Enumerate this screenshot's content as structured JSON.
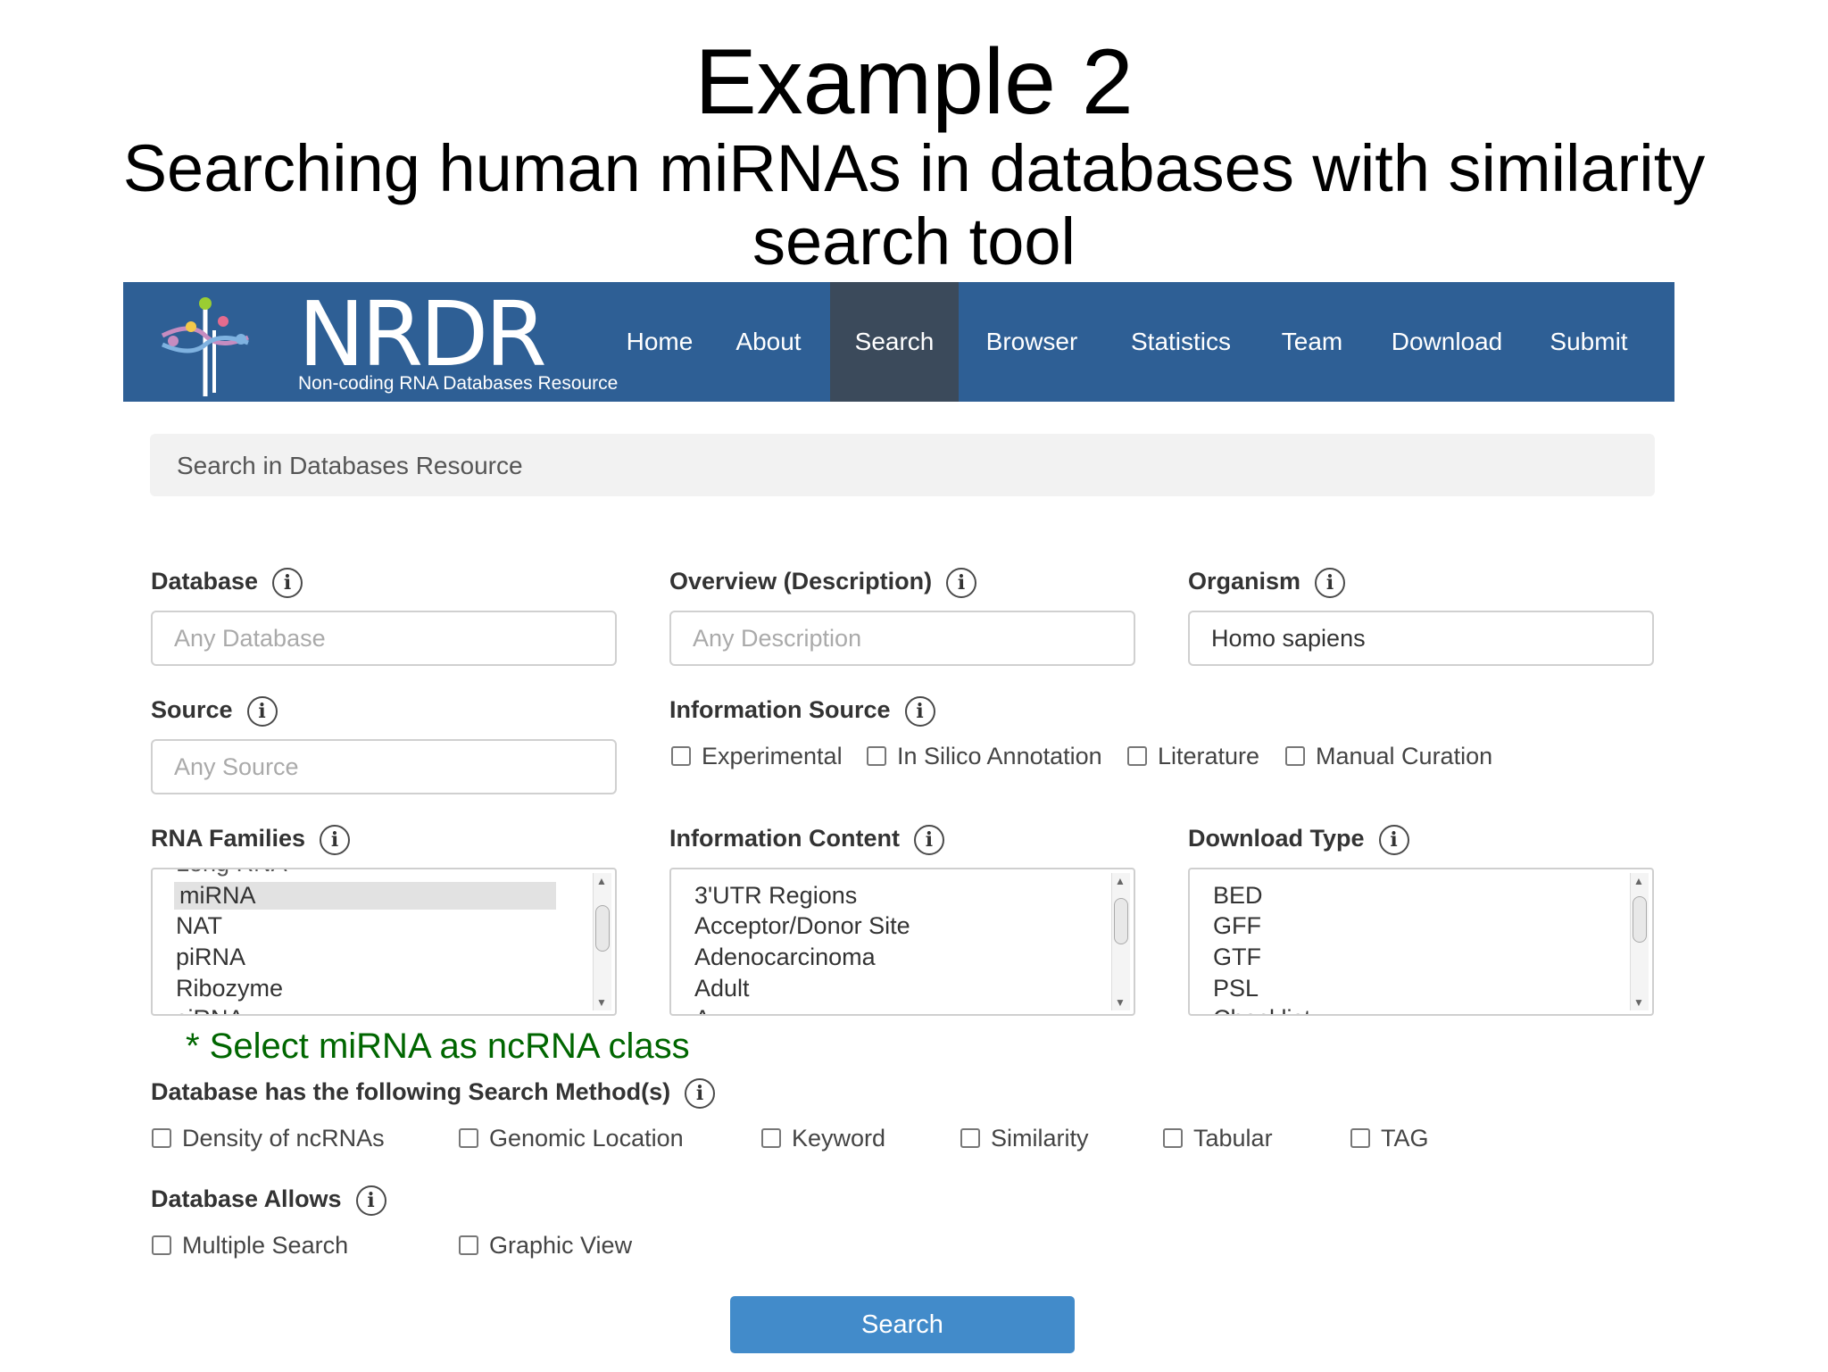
{
  "slide": {
    "title": "Example 2",
    "subtitle": "Searching human miRNAs in databases with similarity search tool"
  },
  "navbar": {
    "logo_text": "NRDR",
    "logo_subtitle": "Non-coding RNA Databases Resource",
    "items": [
      {
        "label": "Home"
      },
      {
        "label": "About"
      },
      {
        "label": "Search"
      },
      {
        "label": "Browser"
      },
      {
        "label": "Statistics"
      },
      {
        "label": "Team"
      },
      {
        "label": "Download"
      },
      {
        "label": "Submit"
      }
    ],
    "active": "Search"
  },
  "search_panel": {
    "heading": "Search in Databases Resource"
  },
  "form": {
    "database": {
      "label": "Database",
      "placeholder": "Any Database"
    },
    "overview": {
      "label": "Overview (Description)",
      "placeholder": "Any Description"
    },
    "organism": {
      "label": "Organism",
      "value": "Homo sapiens"
    },
    "source": {
      "label": "Source",
      "placeholder": "Any Source"
    },
    "information_source": {
      "label": "Information Source",
      "options": [
        "Experimental",
        "In Silico Annotation",
        "Literature",
        "Manual Curation"
      ]
    },
    "rna_families": {
      "label": "RNA Families",
      "items": [
        "Long RNA",
        "miRNA",
        "NAT",
        "piRNA",
        "Ribozyme",
        "siRNA"
      ],
      "selected": "miRNA"
    },
    "information_content": {
      "label": "Information Content",
      "items": [
        "3'UTR Regions",
        "Acceptor/Donor Site",
        "Adenocarcinoma",
        "Adult",
        "A"
      ]
    },
    "download_type": {
      "label": "Download Type",
      "items": [
        "BED",
        "GFF",
        "GTF",
        "PSL",
        "Checklist"
      ]
    },
    "note": "* Select miRNA as ncRNA class",
    "search_methods": {
      "label": "Database has the following Search Method(s)",
      "options": [
        "Density of ncRNAs",
        "Genomic Location",
        "Keyword",
        "Similarity",
        "Tabular",
        "TAG"
      ]
    },
    "allows": {
      "label": "Database Allows",
      "options": [
        "Multiple Search",
        "Graphic View"
      ]
    },
    "submit_label": "Search"
  },
  "icons": {
    "info": "i"
  },
  "colors": {
    "navbar": "#2e5f95",
    "nav_active": "#3b4a5b",
    "button": "#428bca",
    "note": "#006600"
  }
}
